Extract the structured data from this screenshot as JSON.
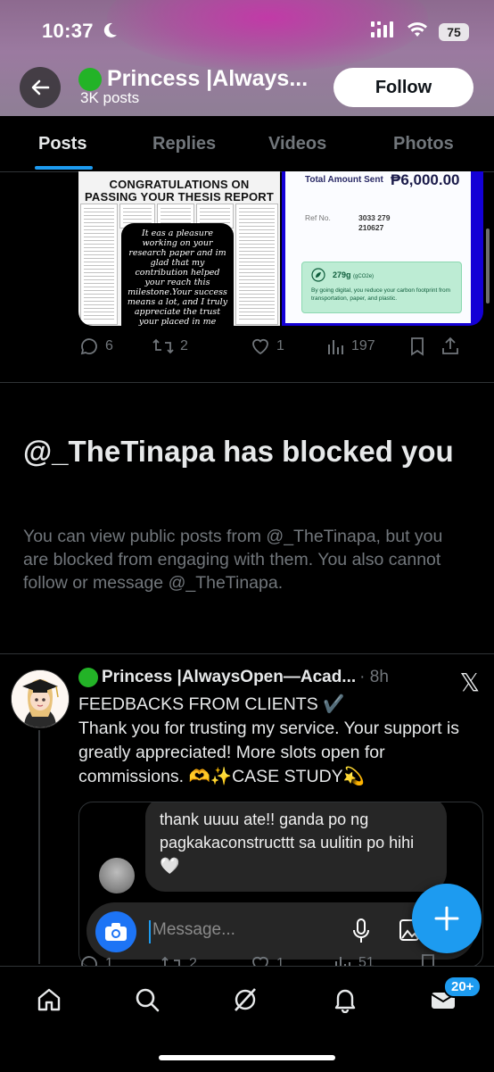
{
  "status_bar": {
    "time": "10:37",
    "battery": "75"
  },
  "profile_header": {
    "name": "Princess |Always...",
    "posts_count": "3K posts",
    "follow_label": "Follow"
  },
  "tabs": [
    {
      "label": "Posts",
      "active": true
    },
    {
      "label": "Replies",
      "active": false
    },
    {
      "label": "Videos",
      "active": false
    },
    {
      "label": "Photos",
      "active": false
    }
  ],
  "first_post": {
    "media_left": {
      "headline": "CONGRATULATIONS ON PASSING YOUR THESIS REPORT",
      "message": "It eas a pleasure working on your research paper and im glad that my contribution helped your reach this milestone.Your success means a lot, and I truly appreciate the trust your placed in me throughout the"
    },
    "media_right": {
      "total_label": "Total Amount Sent",
      "total_value": "₱6,000.00",
      "ref_label": "Ref No.",
      "ref_value": "3033 279 210627",
      "eco_qty": "279g",
      "eco_unit": "(gCO2e)",
      "eco_text": "By going digital, you reduce your carbon footprint from transportation, paper, and plastic."
    },
    "replies": "6",
    "reposts": "2",
    "likes": "1",
    "views": "197"
  },
  "blocked_notice": {
    "title": "@_TheTinapa has blocked you",
    "description": "You can view public posts from @_TheTinapa, but you are blocked from engaging with them. You also cannot follow or message @_TheTinapa."
  },
  "second_post": {
    "author": "Princess |AlwaysOpen—Acad...",
    "time": "· 8h",
    "x_label": "𝕏",
    "text_line1": "FEEDBACKS FROM CLIENTS ✔️",
    "text_body": "Thank you for trusting my service. Your support is greatly appreciated! More slots open for commissions. 🫶✨CASE STUDY💫",
    "chat_message": "thank uuuu ate!! ganda po ng pagkakaconstructtt sa uulitin po hihi🤍",
    "message_placeholder": "Message...",
    "replies": "1",
    "reposts": "2",
    "likes": "1",
    "views": "51"
  },
  "bottom_nav": {
    "badge": "20+"
  },
  "colors": {
    "accent": "#1d9bf0",
    "background": "#000000",
    "muted": "#71767b",
    "green": "#23b327"
  }
}
